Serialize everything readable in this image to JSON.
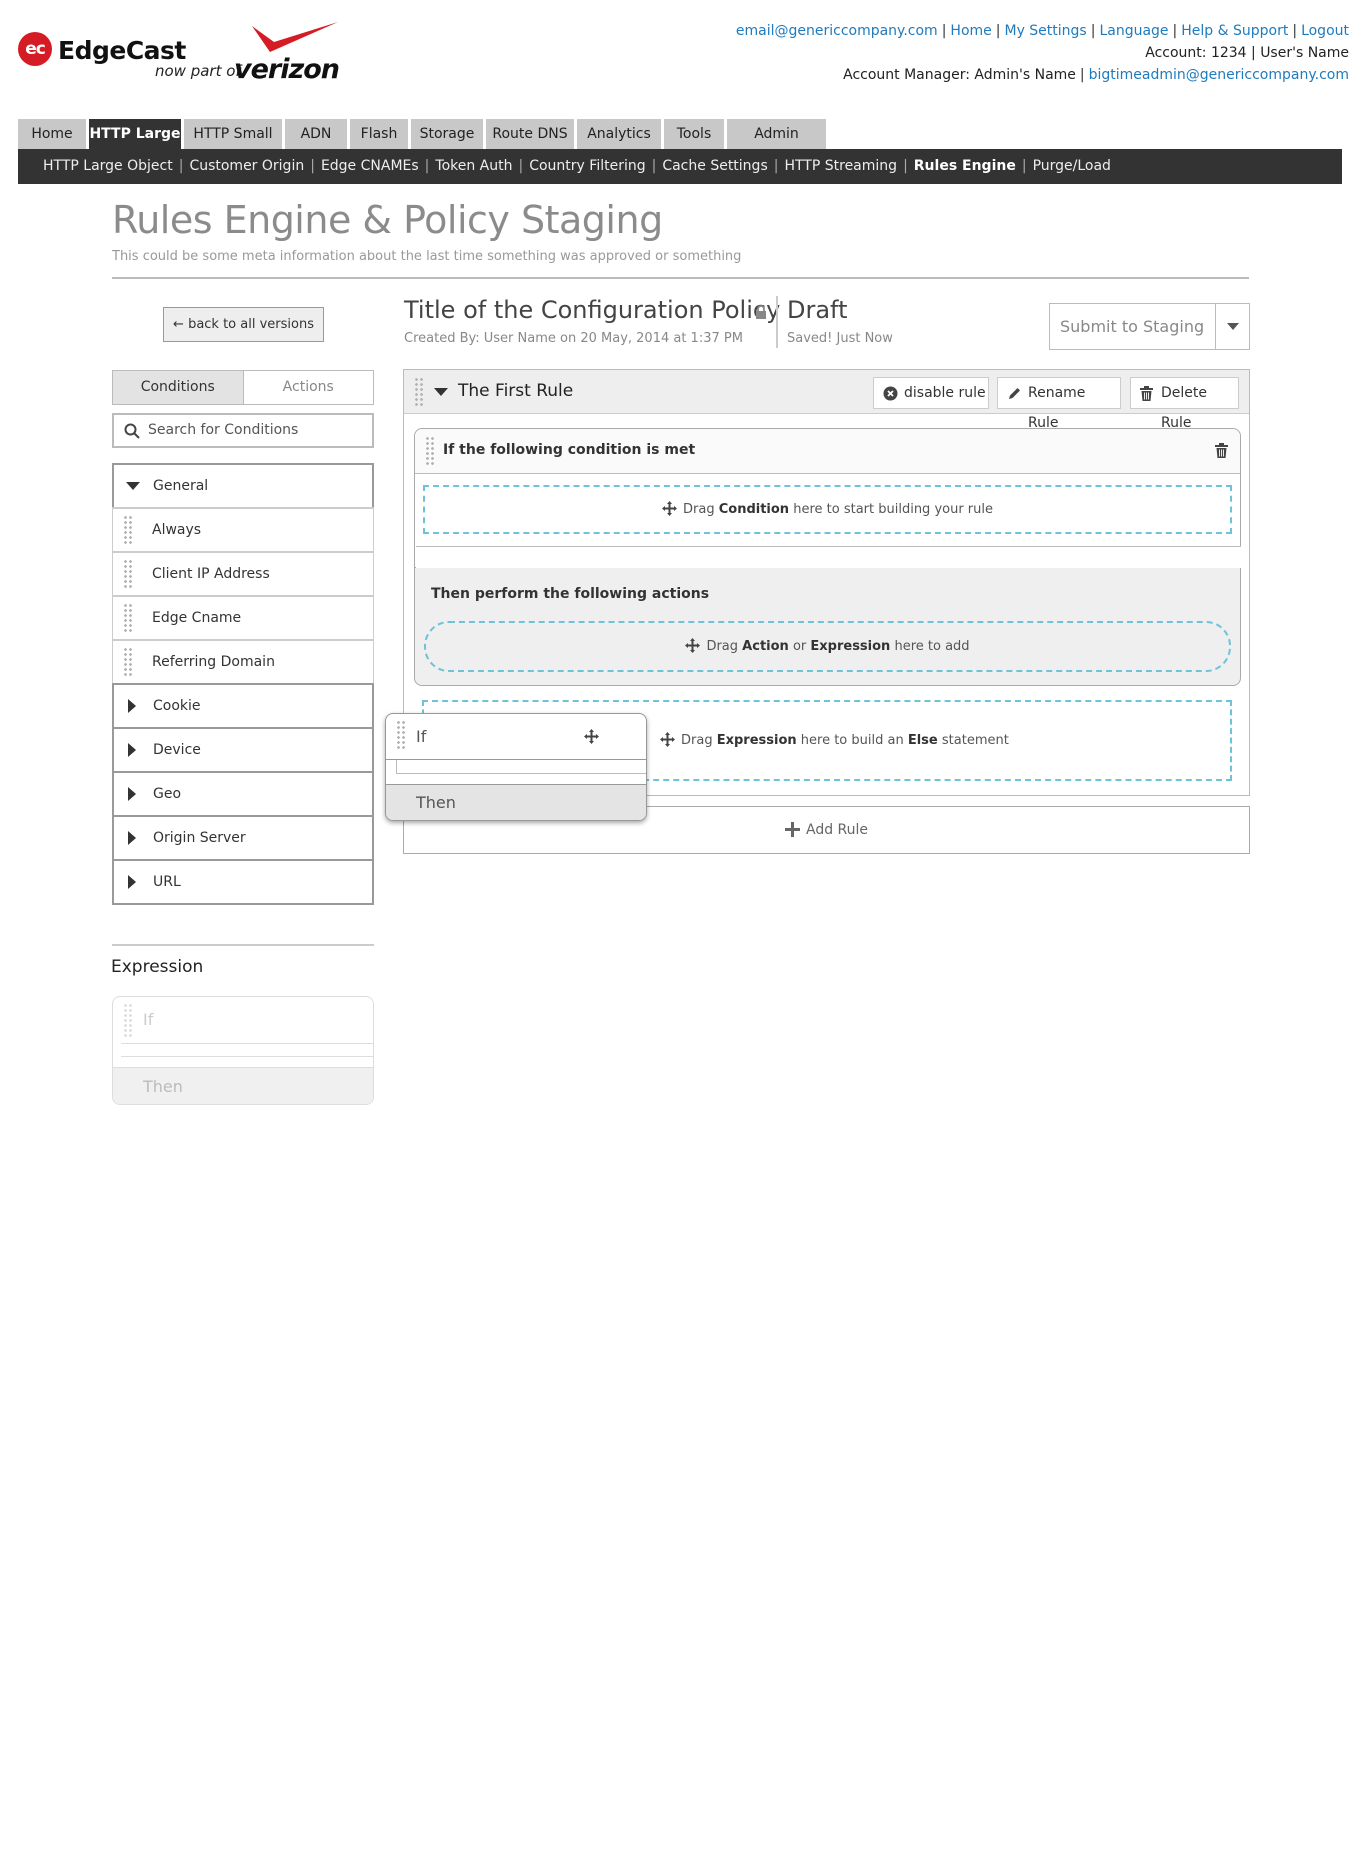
{
  "brand": {
    "logo_mark": "ec",
    "name": "EdgeCast",
    "tagline": "now part of",
    "partner": "verizon"
  },
  "top_links": {
    "email": "email@genericcompany.com",
    "home": "Home",
    "settings": "My Settings",
    "language": "Language",
    "help": "Help & Support",
    "logout": "Logout",
    "account": "Account: 1234 | User's Name",
    "manager_label": "Account Manager: Admin's Name",
    "manager_email": "bigtimeadmin@genericcompany.com"
  },
  "main_tabs": [
    "Home",
    "HTTP Large",
    "HTTP Small",
    "ADN",
    "Flash",
    "Storage",
    "Route DNS",
    "Analytics",
    "Tools",
    "Admin"
  ],
  "sub_nav": [
    "HTTP Large Object",
    "Customer Origin",
    "Edge CNAMEs",
    "Token Auth",
    "Country Filtering",
    "Cache Settings",
    "HTTP Streaming",
    "Rules Engine",
    "Purge/Load"
  ],
  "page": {
    "title": "Rules Engine & Policy Staging",
    "meta": "This could be some meta information about the last time something was approved or something"
  },
  "sidebar": {
    "back_label": "back to all versions",
    "tab_conditions": "Conditions",
    "tab_actions": "Actions",
    "search_placeholder": "Search for Conditions",
    "groups": [
      {
        "label": "General"
      },
      {
        "label": "Always"
      },
      {
        "label": "Client IP Address"
      },
      {
        "label": "Edge Cname"
      },
      {
        "label": "Referring Domain"
      },
      {
        "label": "Cookie"
      },
      {
        "label": "Device"
      },
      {
        "label": "Geo"
      },
      {
        "label": "Origin Server"
      },
      {
        "label": "URL"
      }
    ],
    "expression_title": "Expression",
    "expression_if": "If",
    "expression_then": "Then"
  },
  "policy": {
    "title": "Title of the Configuration Policy",
    "created": "Created By: User Name on 20 May, 2014 at 1:37 PM",
    "status": "Draft",
    "saved": "Saved! Just Now",
    "submit_label": "Submit to Staging"
  },
  "rule": {
    "name": "The First Rule",
    "disable_label": "disable rule",
    "rename_label": "Rename Rule",
    "delete_label": "Delete Rule",
    "condition_heading": "If the following condition is met",
    "condition_drop": {
      "pre": "Drag",
      "bold": "Condition",
      "post": "here to start building your rule"
    },
    "actions_heading": "Then perform the following actions",
    "action_drop": {
      "pre": "Drag",
      "bold1": "Action",
      "mid": "or",
      "bold2": "Expression",
      "post": "here to add"
    },
    "else_drop": {
      "pre": "Drag",
      "bold1": "Expression",
      "mid": "here to build an",
      "bold2": "Else",
      "post": "statement"
    },
    "add_rule": "Add Rule"
  },
  "drag_card": {
    "if": "If",
    "then": "Then"
  },
  "colors": {
    "accent_link": "#1f7bbd",
    "nav_dark": "#333333",
    "dashed_drop": "#6fc3d8",
    "brand_red": "#d51c24"
  }
}
